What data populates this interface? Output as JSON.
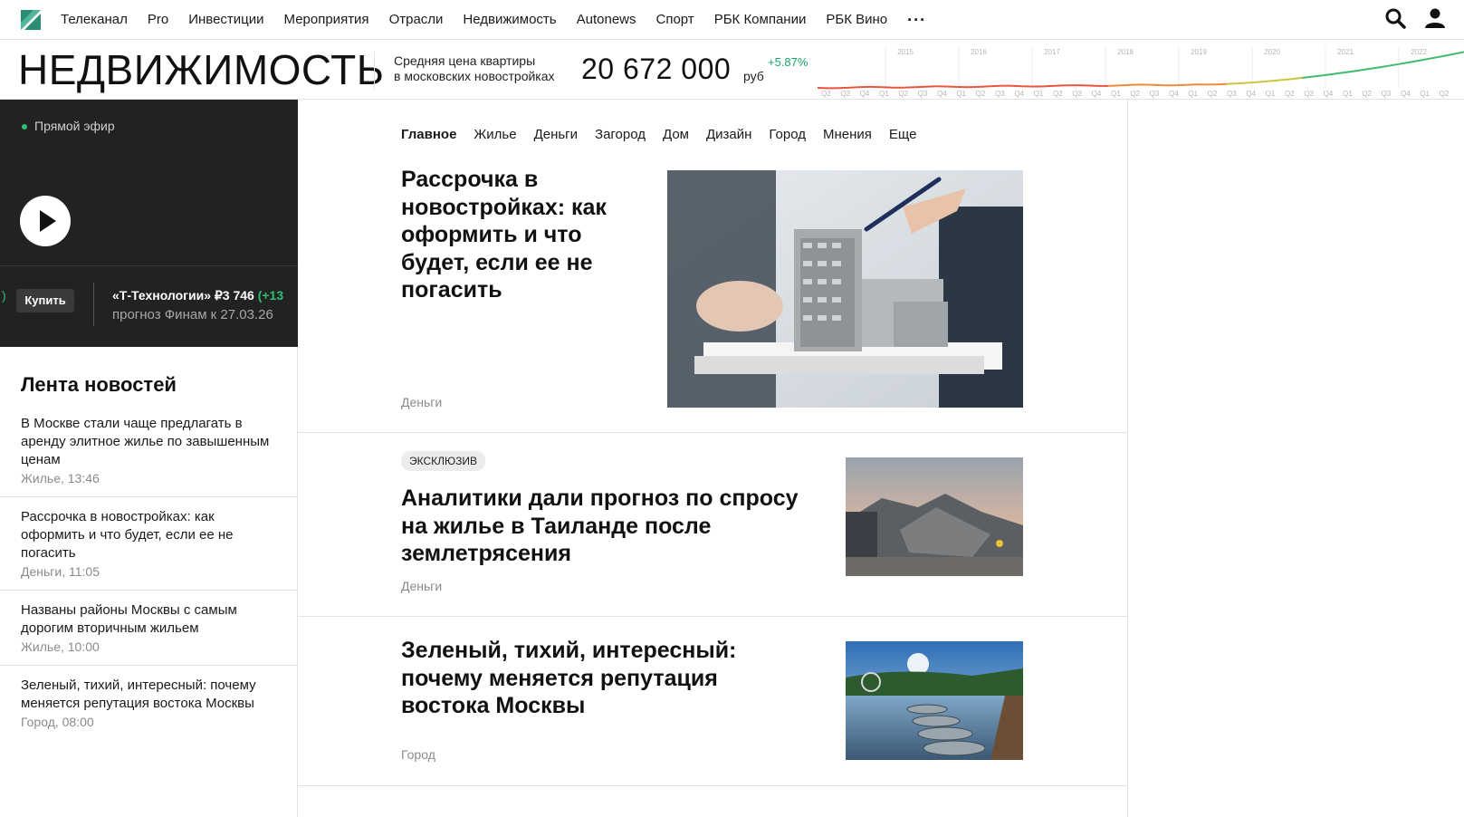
{
  "topnav": {
    "items": [
      "Телеканал",
      "Pro",
      "Инвестиции",
      "Мероприятия",
      "Отрасли",
      "Недвижимость",
      "Autonews",
      "Спорт",
      "РБК Компании",
      "РБК Вино"
    ],
    "more": "···"
  },
  "header": {
    "section_title": "НЕДВИЖИМОСТЬ",
    "price_label_line1": "Средняя цена квартиры",
    "price_label_line2": "в московских новостройках",
    "price_value": "20 672 000",
    "price_unit": "руб",
    "price_change": "+5.87%",
    "chart_years": [
      "2015",
      "2016",
      "2017",
      "2018",
      "2019",
      "2020",
      "2021",
      "2022"
    ],
    "chart_quarters": [
      "Q2",
      "Q3",
      "Q4",
      "Q1",
      "Q2",
      "Q3",
      "Q4",
      "Q1",
      "Q2",
      "Q3",
      "Q4",
      "Q1",
      "Q2",
      "Q3",
      "Q4",
      "Q1",
      "Q2",
      "Q3",
      "Q4",
      "Q1",
      "Q2",
      "Q3",
      "Q4",
      "Q1",
      "Q2",
      "Q3",
      "Q4",
      "Q1",
      "Q2",
      "Q3",
      "Q4",
      "Q1",
      "Q2"
    ]
  },
  "live": {
    "label": "Прямой эфир"
  },
  "promo": {
    "paren": ")",
    "buy_label": "Купить",
    "name": "«Т-Технологии» ₽3 746",
    "change": "(+13",
    "sub": "прогноз Финам к 27.03.26"
  },
  "feed": {
    "title": "Лента новостей",
    "items": [
      {
        "text": "В Москве стали чаще предлагать в аренду элитное жилье по завышенным ценам",
        "meta": "Жилье, 13:46"
      },
      {
        "text": "Рассрочка в новостройках: как оформить и что будет, если ее не погасить",
        "meta": "Деньги, 11:05"
      },
      {
        "text": "Названы районы Москвы с самым дорогим вторичным жильем",
        "meta": "Жилье, 10:00"
      },
      {
        "text": "Зеленый, тихий, интересный: почему меняется репутация востока Москвы",
        "meta": "Город, 08:00"
      }
    ]
  },
  "tabs": [
    "Главное",
    "Жилье",
    "Деньги",
    "Загород",
    "Дом",
    "Дизайн",
    "Город",
    "Мнения",
    "Еще"
  ],
  "cards": [
    {
      "headline": "Рассрочка в новостройках: как оформить и что будет, если ее не погасить",
      "rubric": "Деньги"
    },
    {
      "badge": "ЭКСКЛЮЗИВ",
      "headline": "Аналитики дали прогноз по спросу на жилье в Таиланде после землетрясения",
      "rubric": "Деньги"
    },
    {
      "headline": "Зеленый, тихий, интересный: почему меняется репутация востока Москвы",
      "rubric": "Город"
    }
  ],
  "colors": {
    "accent_green": "#18a46a",
    "dark_panel": "#222222"
  },
  "icons": [
    "rbc-logo-icon",
    "search-icon",
    "user-icon",
    "play-icon"
  ]
}
